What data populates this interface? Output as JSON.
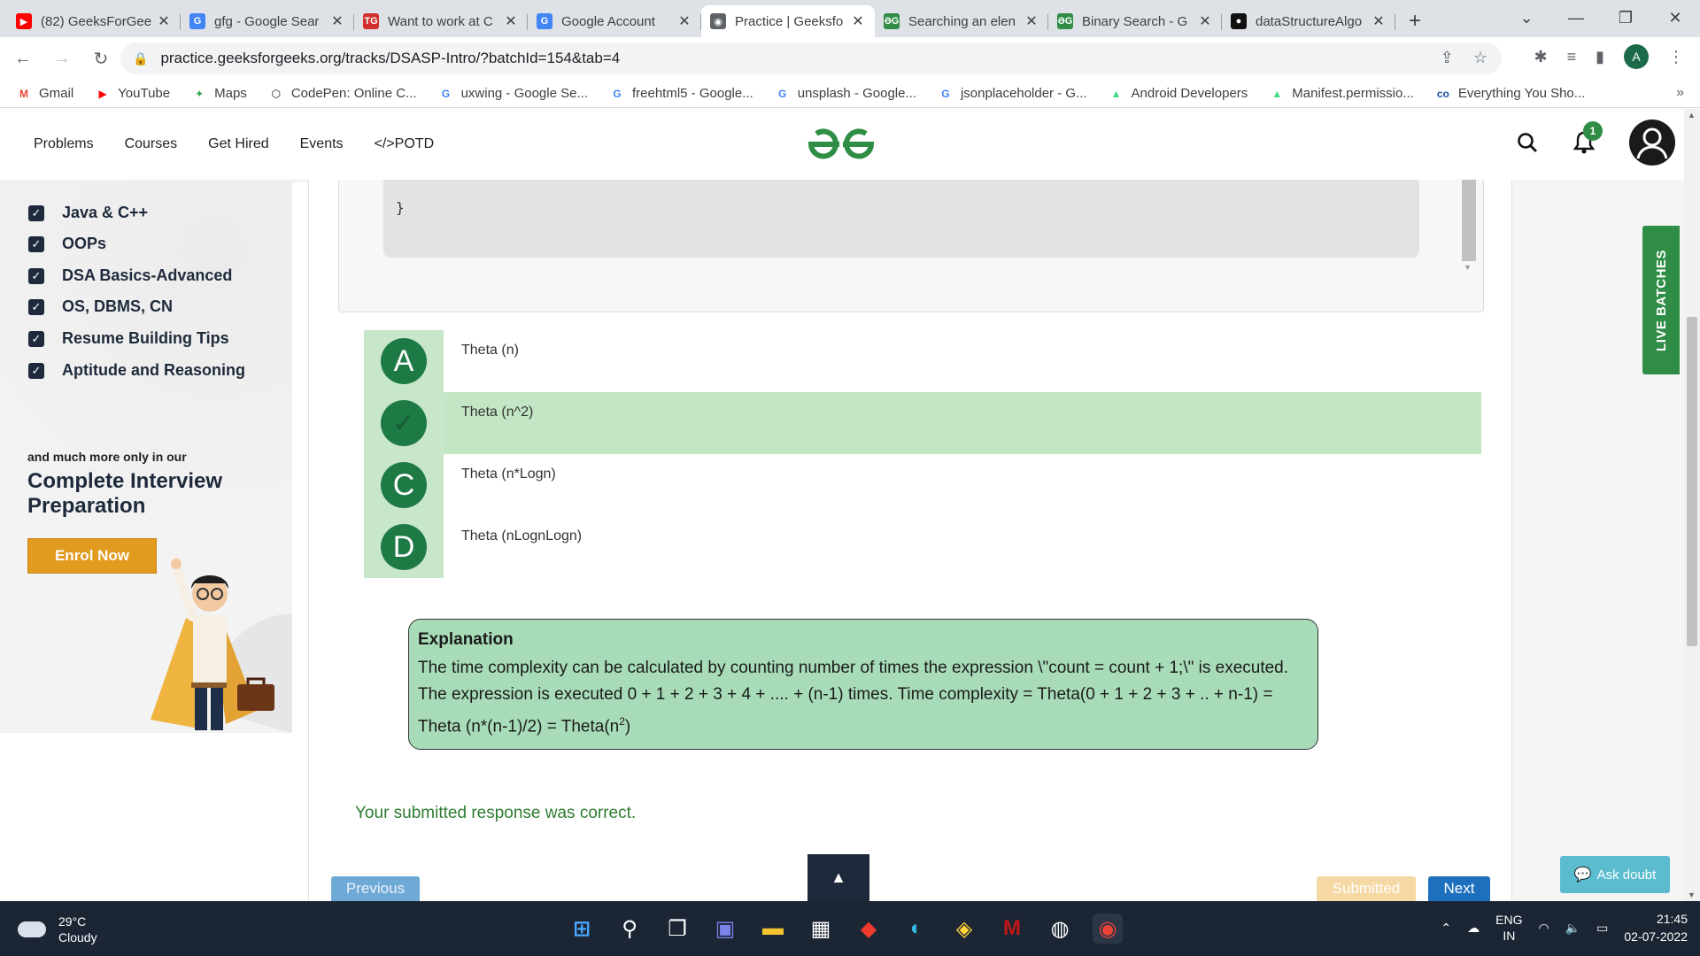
{
  "browser": {
    "tabs": [
      {
        "title": "(82) GeeksForGee",
        "favicon": "youtube-icon",
        "color": "#ff0000",
        "glyph": "▶",
        "active": false
      },
      {
        "title": "gfg - Google Sear",
        "favicon": "google-icon",
        "color": "#4285f4",
        "glyph": "G",
        "active": false
      },
      {
        "title": "Want to work at C",
        "favicon": "tg-icon",
        "color": "#d32f2f",
        "glyph": "TG",
        "active": false
      },
      {
        "title": "Google Account",
        "favicon": "google-icon",
        "color": "#4285f4",
        "glyph": "G",
        "active": false
      },
      {
        "title": "Practice | Geeksfo",
        "favicon": "globe-icon",
        "color": "#5f6368",
        "glyph": "◉",
        "active": true
      },
      {
        "title": "Searching an elen",
        "favicon": "gfg-icon",
        "color": "#2f8d46",
        "glyph": "ƏG",
        "active": false
      },
      {
        "title": "Binary Search - G",
        "favicon": "gfg-icon",
        "color": "#2f8d46",
        "glyph": "ƏG",
        "active": false
      },
      {
        "title": "dataStructureAlgo",
        "favicon": "github-icon",
        "color": "#111111",
        "glyph": "●",
        "active": false
      }
    ],
    "url": "practice.geeksforgeeks.org/tracks/DSASP-Intro/?batchId=154&tab=4",
    "profile_initial": "A",
    "bookmarks": [
      {
        "label": "Gmail",
        "icon": "gmail-icon",
        "glyph": "M",
        "color": "#ea4335"
      },
      {
        "label": "YouTube",
        "icon": "youtube-icon",
        "glyph": "▶",
        "color": "#ff0000"
      },
      {
        "label": "Maps",
        "icon": "maps-icon",
        "glyph": "✦",
        "color": "#34a853"
      },
      {
        "label": "CodePen: Online C...",
        "icon": "codepen-icon",
        "glyph": "⬡",
        "color": "#111111"
      },
      {
        "label": "uxwing - Google Se...",
        "icon": "google-icon",
        "glyph": "G",
        "color": "#4285f4"
      },
      {
        "label": "freehtml5 - Google...",
        "icon": "google-icon",
        "glyph": "G",
        "color": "#4285f4"
      },
      {
        "label": "unsplash - Google...",
        "icon": "google-icon",
        "glyph": "G",
        "color": "#4285f4"
      },
      {
        "label": "jsonplaceholder - G...",
        "icon": "google-icon",
        "glyph": "G",
        "color": "#4285f4"
      },
      {
        "label": "Android Developers",
        "icon": "android-icon",
        "glyph": "▲",
        "color": "#3ddc84"
      },
      {
        "label": "Manifest.permissio...",
        "icon": "android-icon",
        "glyph": "▲",
        "color": "#3ddc84"
      },
      {
        "label": "Everything You Sho...",
        "icon": "co-icon",
        "glyph": "co",
        "color": "#1a4fa0"
      }
    ],
    "bookmarks_more": "»"
  },
  "site": {
    "nav": [
      "Problems",
      "Courses",
      "Get Hired",
      "Events",
      "</>POTD"
    ],
    "notification_count": "1",
    "brand_color": "#2f8d46"
  },
  "sidebar": {
    "checklist": [
      "Java & C++",
      "OOPs",
      "DSA Basics-Advanced",
      "OS, DBMS, CN",
      "Resume Building Tips",
      "Aptitude and Reasoning"
    ],
    "promo_small": "and much more only in our",
    "promo_big": "Complete Interview Preparation",
    "enrol_label": "Enrol Now"
  },
  "question": {
    "code_tail": "}",
    "options": [
      {
        "letter": "A",
        "text": "Theta (n)",
        "correct": false
      },
      {
        "letter": "✓",
        "text": "Theta (n^2)",
        "correct": true
      },
      {
        "letter": "C",
        "text": "Theta (n*Logn)",
        "correct": false
      },
      {
        "letter": "D",
        "text": "Theta (nLognLogn)",
        "correct": false
      }
    ],
    "explanation_title": "Explanation",
    "explanation_text": "The time complexity can be calculated by counting number of times the expression \\\"count = count + 1;\\\" is executed. The expression is executed 0 + 1 + 2 + 3 + 4 + .... + (n-1) times. Time complexity = Theta(0 + 1 + 2 + 3 + .. + n-1) = Theta (n*(n-1)/2) = Theta(n",
    "explanation_sup": "2",
    "explanation_end": ")",
    "result": "Your submitted response was correct.",
    "buttons": {
      "previous": "Previous",
      "top": "▲",
      "submitted": "Submitted",
      "next": "Next"
    }
  },
  "right": {
    "live_batches": "LIVE BATCHES",
    "ask_doubt": "Ask doubt"
  },
  "taskbar": {
    "temp": "29°C",
    "weather": "Cloudy",
    "lang_top": "ENG",
    "lang_bottom": "IN",
    "time": "21:45",
    "date": "02-07-2022",
    "apps": [
      {
        "name": "windows-start-icon",
        "glyph": "⊞",
        "color": "#4aa8ff"
      },
      {
        "name": "search-icon",
        "glyph": "⚲",
        "color": "#ffffff"
      },
      {
        "name": "task-view-icon",
        "glyph": "❐",
        "color": "#ffffff"
      },
      {
        "name": "teams-chat-icon",
        "glyph": "▣",
        "color": "#7b83eb"
      },
      {
        "name": "file-explorer-icon",
        "glyph": "▬",
        "color": "#f4c430"
      },
      {
        "name": "ms-store-icon",
        "glyph": "▦",
        "color": "#ffffff"
      },
      {
        "name": "anydesk-icon",
        "glyph": "◆",
        "color": "#ef3b2d"
      },
      {
        "name": "edge-icon",
        "glyph": "◐",
        "color": "#34b8e5"
      },
      {
        "name": "python-icon",
        "glyph": "◈",
        "color": "#ffd43b"
      },
      {
        "name": "mcafee-icon",
        "glyph": "M",
        "color": "#c01818"
      },
      {
        "name": "app-icon",
        "glyph": "◍",
        "color": "#ffffff"
      },
      {
        "name": "chrome-icon",
        "glyph": "◉",
        "color": "#ea4335"
      }
    ]
  }
}
